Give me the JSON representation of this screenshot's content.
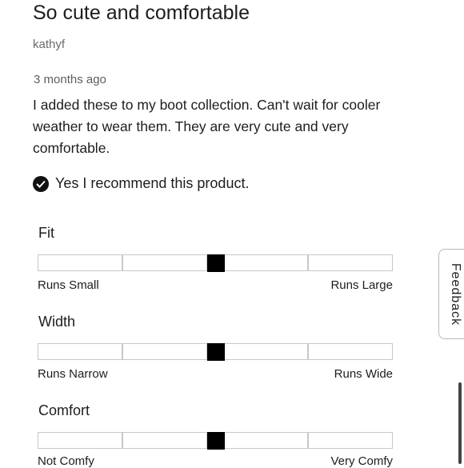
{
  "review": {
    "title": "So cute and comfortable",
    "author": "kathyf",
    "date": "3 months ago",
    "body": "I added these to my boot collection. Can't wait for cooler weather to wear them. They are very cute and very comfortable.",
    "recommendation": "Yes I recommend this product.",
    "recommend_icon": "check-circle-icon"
  },
  "ratings": [
    {
      "label": "Fit",
      "low": "Runs Small",
      "high": "Runs Large",
      "value": 0.5
    },
    {
      "label": "Width",
      "low": "Runs Narrow",
      "high": "Runs Wide",
      "value": 0.5
    },
    {
      "label": "Comfort",
      "low": "Not Comfy",
      "high": "Very Comfy",
      "value": 0.5
    }
  ],
  "feedback_tab": {
    "label": "Feedback"
  },
  "colors": {
    "knob": "#000000",
    "segment_border": "#c8c8c8",
    "text": "#1d1d1d",
    "muted": "#6c6c6c"
  }
}
